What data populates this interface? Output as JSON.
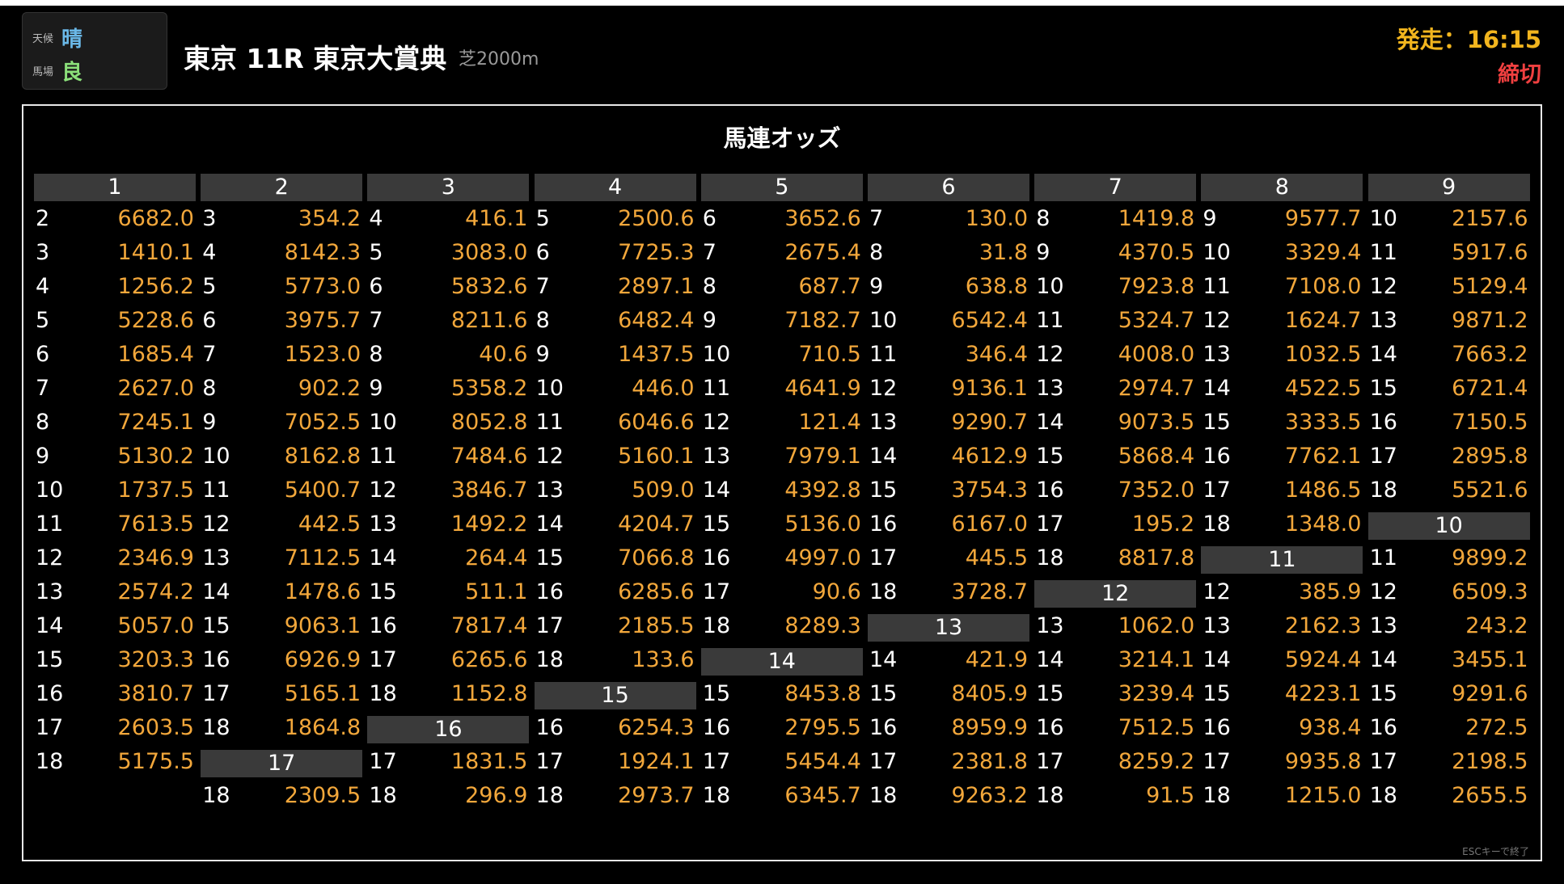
{
  "condition": {
    "weather_label": "天候",
    "weather_value": "晴",
    "track_label": "馬場",
    "track_value": "良"
  },
  "race": {
    "title": "東京 11R 東京大賞典",
    "course": "芝2000m",
    "start_time": "発走：16:15",
    "status": "締切"
  },
  "colors": {
    "odds": "#f2a73b",
    "start": "#f2b51e",
    "status": "#f04040",
    "header_bg": "#3a3a3a"
  },
  "panel": {
    "title": "馬連オッズ",
    "esc_hint": "ESCキーで終了"
  },
  "blocks": [
    {
      "horse": "1",
      "odds": [
        [
          "2",
          "6682.0"
        ],
        [
          "3",
          "1410.1"
        ],
        [
          "4",
          "1256.2"
        ],
        [
          "5",
          "5228.6"
        ],
        [
          "6",
          "1685.4"
        ],
        [
          "7",
          "2627.0"
        ],
        [
          "8",
          "7245.1"
        ],
        [
          "9",
          "5130.2"
        ],
        [
          "10",
          "1737.5"
        ],
        [
          "11",
          "7613.5"
        ],
        [
          "12",
          "2346.9"
        ],
        [
          "13",
          "2574.2"
        ],
        [
          "14",
          "5057.0"
        ],
        [
          "15",
          "3203.3"
        ],
        [
          "16",
          "3810.7"
        ],
        [
          "17",
          "2603.5"
        ],
        [
          "18",
          "5175.5"
        ]
      ]
    },
    {
      "horse": "2",
      "odds": [
        [
          "3",
          "354.2"
        ],
        [
          "4",
          "8142.3"
        ],
        [
          "5",
          "5773.0"
        ],
        [
          "6",
          "3975.7"
        ],
        [
          "7",
          "1523.0"
        ],
        [
          "8",
          "902.2"
        ],
        [
          "9",
          "7052.5"
        ],
        [
          "10",
          "8162.8"
        ],
        [
          "11",
          "5400.7"
        ],
        [
          "12",
          "442.5"
        ],
        [
          "13",
          "7112.5"
        ],
        [
          "14",
          "1478.6"
        ],
        [
          "15",
          "9063.1"
        ],
        [
          "16",
          "6926.9"
        ],
        [
          "17",
          "5165.1"
        ],
        [
          "18",
          "1864.8"
        ]
      ]
    },
    {
      "horse": "3",
      "odds": [
        [
          "4",
          "416.1"
        ],
        [
          "5",
          "3083.0"
        ],
        [
          "6",
          "5832.6"
        ],
        [
          "7",
          "8211.6"
        ],
        [
          "8",
          "40.6"
        ],
        [
          "9",
          "5358.2"
        ],
        [
          "10",
          "8052.8"
        ],
        [
          "11",
          "7484.6"
        ],
        [
          "12",
          "3846.7"
        ],
        [
          "13",
          "1492.2"
        ],
        [
          "14",
          "264.4"
        ],
        [
          "15",
          "511.1"
        ],
        [
          "16",
          "7817.4"
        ],
        [
          "17",
          "6265.6"
        ],
        [
          "18",
          "1152.8"
        ]
      ]
    },
    {
      "horse": "4",
      "odds": [
        [
          "5",
          "2500.6"
        ],
        [
          "6",
          "7725.3"
        ],
        [
          "7",
          "2897.1"
        ],
        [
          "8",
          "6482.4"
        ],
        [
          "9",
          "1437.5"
        ],
        [
          "10",
          "446.0"
        ],
        [
          "11",
          "6046.6"
        ],
        [
          "12",
          "5160.1"
        ],
        [
          "13",
          "509.0"
        ],
        [
          "14",
          "4204.7"
        ],
        [
          "15",
          "7066.8"
        ],
        [
          "16",
          "6285.6"
        ],
        [
          "17",
          "2185.5"
        ],
        [
          "18",
          "133.6"
        ]
      ]
    },
    {
      "horse": "5",
      "odds": [
        [
          "6",
          "3652.6"
        ],
        [
          "7",
          "2675.4"
        ],
        [
          "8",
          "687.7"
        ],
        [
          "9",
          "7182.7"
        ],
        [
          "10",
          "710.5"
        ],
        [
          "11",
          "4641.9"
        ],
        [
          "12",
          "121.4"
        ],
        [
          "13",
          "7979.1"
        ],
        [
          "14",
          "4392.8"
        ],
        [
          "15",
          "5136.0"
        ],
        [
          "16",
          "4997.0"
        ],
        [
          "17",
          "90.6"
        ],
        [
          "18",
          "8289.3"
        ]
      ]
    },
    {
      "horse": "6",
      "odds": [
        [
          "7",
          "130.0"
        ],
        [
          "8",
          "31.8"
        ],
        [
          "9",
          "638.8"
        ],
        [
          "10",
          "6542.4"
        ],
        [
          "11",
          "346.4"
        ],
        [
          "12",
          "9136.1"
        ],
        [
          "13",
          "9290.7"
        ],
        [
          "14",
          "4612.9"
        ],
        [
          "15",
          "3754.3"
        ],
        [
          "16",
          "6167.0"
        ],
        [
          "17",
          "445.5"
        ],
        [
          "18",
          "3728.7"
        ]
      ]
    },
    {
      "horse": "7",
      "odds": [
        [
          "8",
          "1419.8"
        ],
        [
          "9",
          "4370.5"
        ],
        [
          "10",
          "7923.8"
        ],
        [
          "11",
          "5324.7"
        ],
        [
          "12",
          "4008.0"
        ],
        [
          "13",
          "2974.7"
        ],
        [
          "14",
          "9073.5"
        ],
        [
          "15",
          "5868.4"
        ],
        [
          "16",
          "7352.0"
        ],
        [
          "17",
          "195.2"
        ],
        [
          "18",
          "8817.8"
        ]
      ]
    },
    {
      "horse": "8",
      "odds": [
        [
          "9",
          "9577.7"
        ],
        [
          "10",
          "3329.4"
        ],
        [
          "11",
          "7108.0"
        ],
        [
          "12",
          "1624.7"
        ],
        [
          "13",
          "1032.5"
        ],
        [
          "14",
          "4522.5"
        ],
        [
          "15",
          "3333.5"
        ],
        [
          "16",
          "7762.1"
        ],
        [
          "17",
          "1486.5"
        ],
        [
          "18",
          "1348.0"
        ]
      ]
    },
    {
      "horse": "9",
      "odds": [
        [
          "10",
          "2157.6"
        ],
        [
          "11",
          "5917.6"
        ],
        [
          "12",
          "5129.4"
        ],
        [
          "13",
          "9871.2"
        ],
        [
          "14",
          "7663.2"
        ],
        [
          "15",
          "6721.4"
        ],
        [
          "16",
          "7150.5"
        ],
        [
          "17",
          "2895.8"
        ],
        [
          "18",
          "5521.6"
        ]
      ]
    },
    {
      "horse": "10",
      "odds": [
        [
          "11",
          "9899.2"
        ],
        [
          "12",
          "6509.3"
        ],
        [
          "13",
          "243.2"
        ],
        [
          "14",
          "3455.1"
        ],
        [
          "15",
          "9291.6"
        ],
        [
          "16",
          "272.5"
        ],
        [
          "17",
          "2198.5"
        ],
        [
          "18",
          "2655.5"
        ]
      ]
    },
    {
      "horse": "11",
      "odds": [
        [
          "12",
          "385.9"
        ],
        [
          "13",
          "2162.3"
        ],
        [
          "14",
          "5924.4"
        ],
        [
          "15",
          "4223.1"
        ],
        [
          "16",
          "938.4"
        ],
        [
          "17",
          "9935.8"
        ],
        [
          "18",
          "1215.0"
        ]
      ]
    },
    {
      "horse": "12",
      "odds": [
        [
          "13",
          "1062.0"
        ],
        [
          "14",
          "3214.1"
        ],
        [
          "15",
          "3239.4"
        ],
        [
          "16",
          "7512.5"
        ],
        [
          "17",
          "8259.2"
        ],
        [
          "18",
          "91.5"
        ]
      ]
    },
    {
      "horse": "13",
      "odds": [
        [
          "14",
          "421.9"
        ],
        [
          "15",
          "8405.9"
        ],
        [
          "16",
          "8959.9"
        ],
        [
          "17",
          "2381.8"
        ],
        [
          "18",
          "9263.2"
        ]
      ]
    },
    {
      "horse": "14",
      "odds": [
        [
          "15",
          "8453.8"
        ],
        [
          "16",
          "2795.5"
        ],
        [
          "17",
          "5454.4"
        ],
        [
          "18",
          "6345.7"
        ]
      ]
    },
    {
      "horse": "15",
      "odds": [
        [
          "16",
          "6254.3"
        ],
        [
          "17",
          "1924.1"
        ],
        [
          "18",
          "2973.7"
        ]
      ]
    },
    {
      "horse": "16",
      "odds": [
        [
          "17",
          "1831.5"
        ],
        [
          "18",
          "296.9"
        ]
      ]
    },
    {
      "horse": "17",
      "odds": [
        [
          "18",
          "2309.5"
        ]
      ]
    }
  ]
}
